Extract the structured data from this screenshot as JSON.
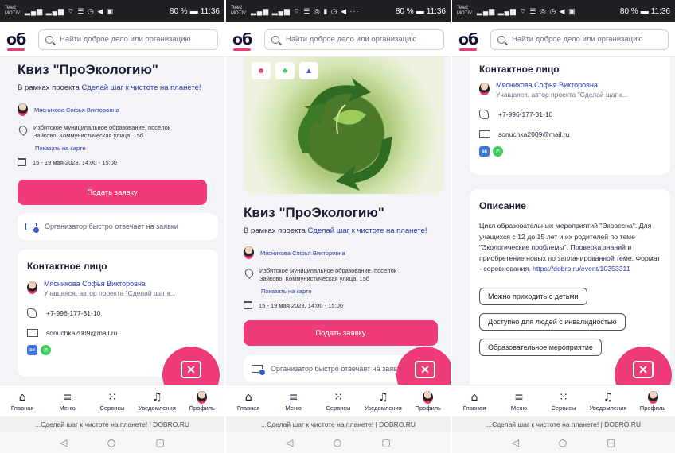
{
  "status": {
    "carrier_line1": "Tele2",
    "carrier_line2": "MOTIV",
    "battery": "80 %",
    "time": "11:36"
  },
  "header": {
    "logo": "об",
    "search_placeholder": "Найти доброе дело или организацию"
  },
  "event": {
    "title": "Квиз \"ПроЭкологию\"",
    "project_prefix": "В рамках проекта",
    "project_link": "Сделай шаг к чистоте на планете!",
    "organizer_name": "Мясникова Софья Викторовна",
    "location_line1": "Избитское муниципальное образование, посёлок",
    "location_line2": "Зайково, Коммунистическая улица, 15б",
    "show_on_map": "Показать на карте",
    "date": "15 - 19 мая 2023, 14:00 - 15:00",
    "apply_button": "Подать заявку",
    "organizer_fast_reply": "Организатор быстро отвечает на заявки"
  },
  "contact": {
    "title": "Контактное лицо",
    "name": "Мясникова Софья Викторовна",
    "role": "Учащаяся, автор проекта \"Сделай шаг к...",
    "phone": "+7-996-177-31-10",
    "email": "sonuchka2009@mail.ru",
    "vk": "вк",
    "wa": "✆"
  },
  "description": {
    "title": "Описание",
    "text": "Цикл образовательных мероприятий \"Эковесна\". Для учащихся с 12 до 15 лет и их родителей по теме \"Экологические проблемы\". Проверка знаний и приобретение новых по запланированной теме. Формат - соревнования.",
    "link": "https://dobro.ru/event/10353311",
    "tags": [
      "Можно приходить с детьми",
      "Доступно для людей с инвалидностью",
      "Образовательное мероприятие"
    ]
  },
  "tabs": [
    "Главная",
    "Меню",
    "Сервисы",
    "Уведомления",
    "Профиль"
  ],
  "url_bar": "...Сделай шаг к чистоте на планете! | DOBRO.RU",
  "colors": {
    "accent": "#ef3b7a",
    "link": "#2a3aa8",
    "dark": "#1f1f24"
  }
}
